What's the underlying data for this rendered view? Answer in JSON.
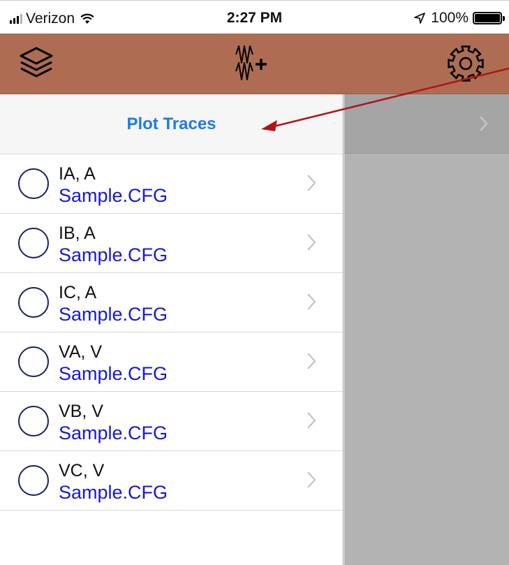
{
  "status_bar": {
    "carrier": "Verizon",
    "time": "2:27 PM",
    "battery": "100%",
    "battery_level": 1.0
  },
  "nav_bar": {
    "left_icon": "layers-icon",
    "center_icon": "waveform-add-icon",
    "right_icon": "gear-icon"
  },
  "plot_traces": {
    "title": "Plot Traces"
  },
  "traces": [
    {
      "name": "IA, A",
      "file": "Sample.CFG"
    },
    {
      "name": "IB, A",
      "file": "Sample.CFG"
    },
    {
      "name": "IC, A",
      "file": "Sample.CFG"
    },
    {
      "name": "VA, V",
      "file": "Sample.CFG"
    },
    {
      "name": "VB, V",
      "file": "Sample.CFG"
    },
    {
      "name": "VC, V",
      "file": "Sample.CFG"
    }
  ],
  "colors": {
    "nav_background": "#ae6d52",
    "link_blue": "#1c7bea",
    "file_blue": "#1717d8",
    "radio_border": "#1a1d6e",
    "annotation_arrow": "#b01515",
    "detail_panel": "#b3b3b3"
  }
}
